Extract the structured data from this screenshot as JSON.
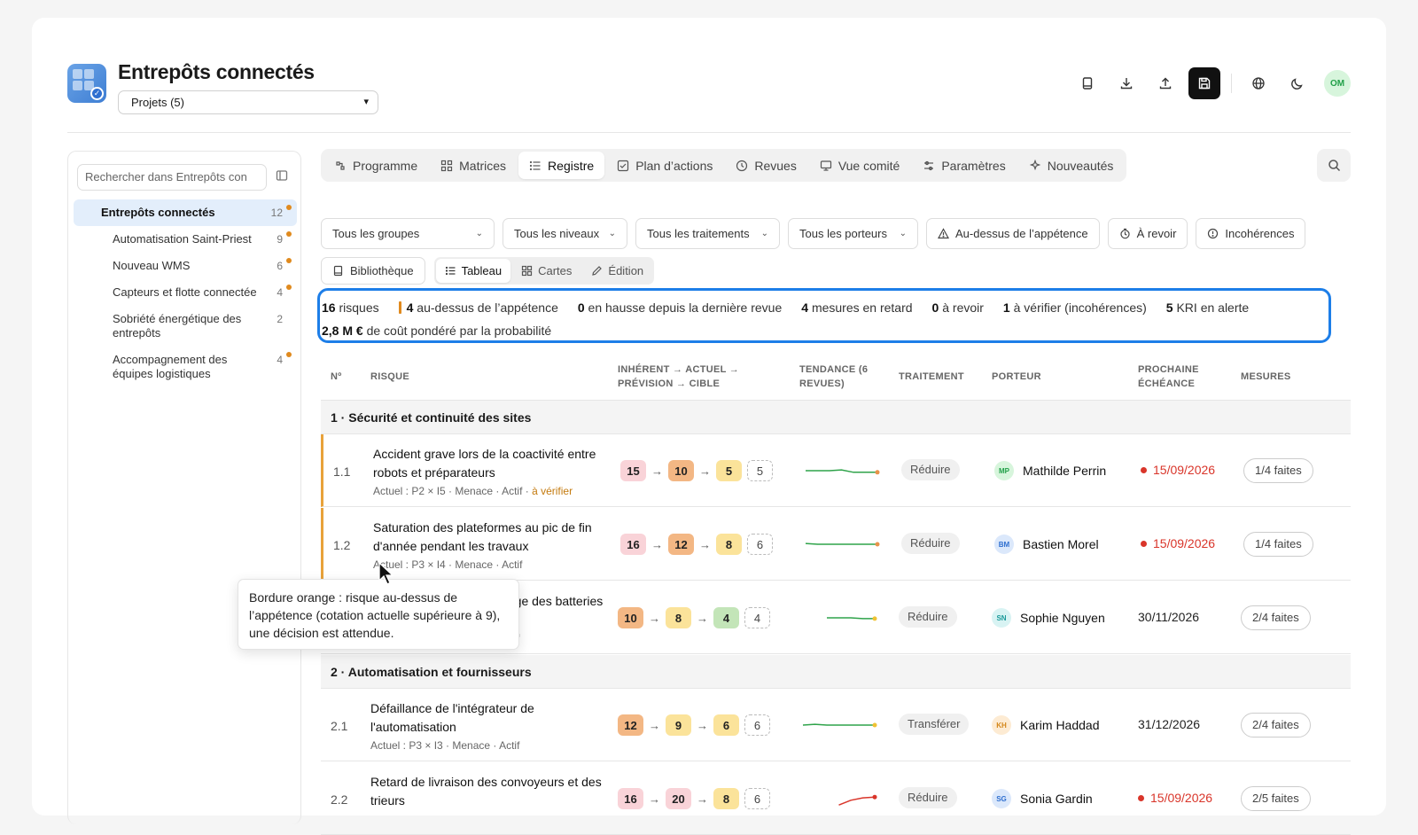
{
  "header": {
    "title": "Entrepôts connectés",
    "project_select": "Projets (5)",
    "avatar": "OM"
  },
  "sidebar": {
    "search_placeholder": "Rechercher dans Entrepôts con",
    "items": [
      {
        "label": "Entrepôts connectés",
        "count": "12",
        "dot": true
      },
      {
        "label": "Automatisation Saint-Priest",
        "count": "9",
        "dot": true
      },
      {
        "label": "Nouveau WMS",
        "count": "6",
        "dot": true
      },
      {
        "label": "Capteurs et flotte connectée",
        "count": "4",
        "dot": true
      },
      {
        "label": "Sobriété énergétique des entrepôts",
        "count": "2",
        "dot": false
      },
      {
        "label": "Accompagnement des équipes logistiques",
        "count": "4",
        "dot": true
      }
    ]
  },
  "tabs": [
    "Programme",
    "Matrices",
    "Registre",
    "Plan d’actions",
    "Revues",
    "Vue comité",
    "Paramètres",
    "Nouveautés"
  ],
  "active_tab": "Registre",
  "filters": {
    "groups": "Tous les groupes",
    "levels": "Tous les niveaux",
    "treatments": "Tous les traitements",
    "owners": "Tous les porteurs",
    "appetite": "Au-dessus de l’appétence",
    "review": "À revoir",
    "inconsistencies": "Incohérences"
  },
  "views": {
    "library": "Bibliothèque",
    "table": "Tableau",
    "cards": "Cartes",
    "edit": "Édition"
  },
  "summary": {
    "risks_n": "16",
    "risks_t": "risques",
    "above_n": "4",
    "above_t": "au-dessus de l’appétence",
    "rise_n": "0",
    "rise_t": "en hausse depuis la dernière revue",
    "late_n": "4",
    "late_t": "mesures en retard",
    "review_n": "0",
    "review_t": "à revoir",
    "check_n": "1",
    "check_t": "à vérifier (incohérences)",
    "kri_n": "5",
    "kri_t": "KRI en alerte",
    "cost_n": "2,8 M €",
    "cost_t": "de coût pondéré par la probabilité"
  },
  "table_headers": {
    "num": "Nº",
    "risk": "RISQUE",
    "scores": "INHÉRENT → ACTUEL → PRÉVISION → CIBLE",
    "trend": "TENDANCE (6 REVUES)",
    "treatment": "TRAITEMENT",
    "owner": "PORTEUR",
    "due": "PROCHAINE ÉCHÉANCE",
    "measures": "MESURES"
  },
  "groups": [
    {
      "label": "1 · Sécurité et continuité des sites"
    },
    {
      "label": "2 · Automatisation et fournisseurs"
    }
  ],
  "rows": [
    {
      "num": "1.1",
      "title": "Accident grave lors de la coactivité entre robots et préparateurs",
      "meta": "Actuel : P2 × I5 · Menace · Actif · ",
      "warn": "à vérifier",
      "s1": "15",
      "s2": "10",
      "s3": "5",
      "s4": "5",
      "treatment": "Réduire",
      "owner": "Mathilde Perrin",
      "initials": "MP",
      "due": "15/09/2026",
      "measures": "1/4 faites"
    },
    {
      "num": "1.2",
      "title": "Saturation des plateformes au pic de fin d'année pendant les travaux",
      "meta": "Actuel : P3 × I4 · Menace · Actif",
      "warn": "",
      "s1": "16",
      "s2": "12",
      "s3": "8",
      "s4": "6",
      "treatment": "Réduire",
      "owner": "Bastien Morel",
      "initials": "BM",
      "due": "15/09/2026",
      "measures": "1/4 faites"
    },
    {
      "num": "1.3",
      "title": "Indisponibilité de la recharge des batteries de la flotte",
      "meta": "Actuel : P2 × I4 · Menace · Actif",
      "warn": "",
      "s1": "10",
      "s2": "8",
      "s3": "4",
      "s4": "4",
      "treatment": "Réduire",
      "owner": "Sophie Nguyen",
      "initials": "SN",
      "due": "30/11/2026",
      "measures": "2/4 faites"
    },
    {
      "num": "2.1",
      "title": "Défaillance de l'intégrateur de l'automatisation",
      "meta": "Actuel : P3 × I3 · Menace · Actif",
      "warn": "",
      "s1": "12",
      "s2": "9",
      "s3": "6",
      "s4": "6",
      "treatment": "Transférer",
      "owner": "Karim Haddad",
      "initials": "KH",
      "due": "31/12/2026",
      "measures": "2/4 faites"
    },
    {
      "num": "2.2",
      "title": "Retard de livraison des convoyeurs et des trieurs",
      "meta": "",
      "warn": "",
      "s1": "16",
      "s2": "20",
      "s3": "8",
      "s4": "6",
      "treatment": "Réduire",
      "owner": "Sonia Gardin",
      "initials": "SG",
      "due": "15/09/2026",
      "measures": "2/5 faites"
    }
  ],
  "trends": [
    [
      0.5,
      0.5,
      0.5,
      0.45,
      0.6,
      0.6,
      0.6
    ],
    [
      0.45,
      0.5,
      0.5,
      0.5,
      0.5,
      0.5,
      0.5
    ],
    [
      null,
      null,
      0.5,
      0.5,
      0.5,
      0.55,
      0.55
    ],
    [
      0.5,
      0.45,
      0.5,
      0.5,
      0.5,
      0.5,
      0.5
    ],
    [
      null,
      null,
      null,
      0.9,
      0.6,
      0.45,
      0.4
    ]
  ],
  "tooltip": "Bordure orange : risque au-dessus de l’appétence (cotation actuelle supérieure à 9), une décision est attendue.",
  "colors": {
    "accent": "#1d7ee8",
    "over_border": "#e8a23a",
    "late": "#d9352a",
    "trend_green": "#2fa34a",
    "trend_red": "#d9352a"
  }
}
